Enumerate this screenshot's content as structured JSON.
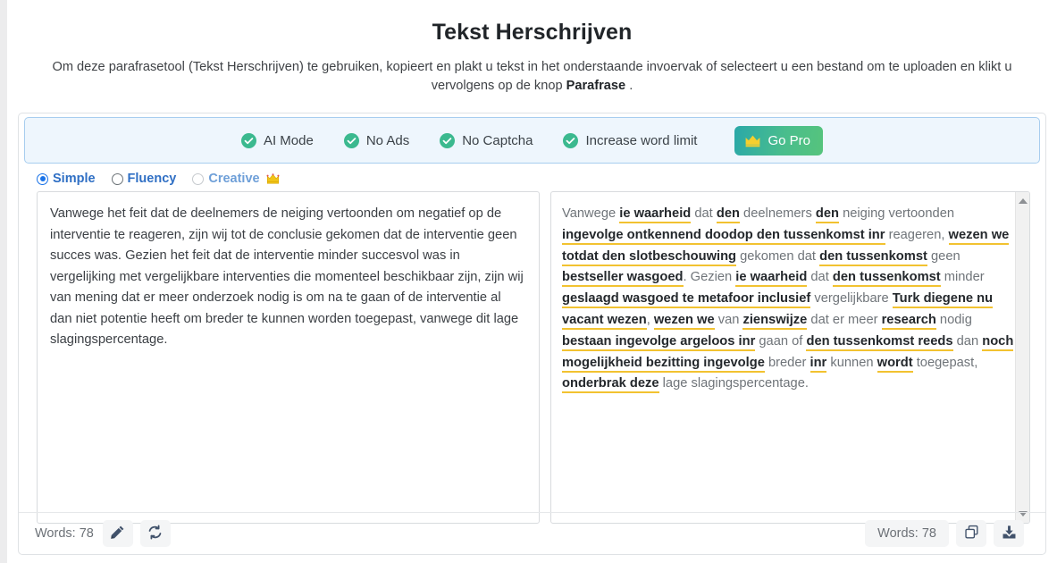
{
  "header": {
    "title": "Tekst Herschrijven",
    "subtitle_before": "Om deze parafrasetool (Tekst Herschrijven) te gebruiken, kopieert en plakt u tekst in het onderstaande invoervak of selecteert u een bestand om te uploaden en klikt u vervolgens op de knop ",
    "subtitle_bold": "Parafrase",
    "subtitle_after": " ."
  },
  "feature_bar": {
    "features": [
      {
        "label": "AI Mode",
        "icon": "check-circle-icon"
      },
      {
        "label": "No Ads",
        "icon": "check-circle-icon"
      },
      {
        "label": "No Captcha",
        "icon": "check-circle-icon"
      },
      {
        "label": "Increase word limit",
        "icon": "check-circle-icon"
      }
    ],
    "go_pro_label": "Go Pro",
    "go_pro_icon": "crown-icon",
    "accent_green": "#3bb98f",
    "accent_blue_bg": "#eef6fd"
  },
  "modes": {
    "options": [
      {
        "label": "Simple",
        "selected": true,
        "disabled": false
      },
      {
        "label": "Fluency",
        "selected": false,
        "disabled": false
      },
      {
        "label": "Creative",
        "selected": false,
        "disabled": true,
        "badge_icon": "crown-icon"
      }
    ]
  },
  "editor": {
    "source_text": "Vanwege het feit dat de deelnemers de neiging vertoonden om negatief op de interventie te reageren, zijn wij tot de conclusie gekomen dat de interventie geen succes was. Gezien het feit dat de interventie minder succesvol was in vergelijking met vergelijkbare interventies die momenteel beschikbaar zijn, zijn wij van mening dat er meer onderzoek nodig is om na te gaan of de interventie al dan niet potentie heeft om breder te kunnen worden toegepast, vanwege dit lage slagingspercentage.",
    "output_tokens": [
      {
        "t": "Vanwege ",
        "h": false
      },
      {
        "t": "ie waarheid",
        "h": true
      },
      {
        "t": " dat ",
        "h": false
      },
      {
        "t": "den",
        "h": true
      },
      {
        "t": " deelnemers ",
        "h": false
      },
      {
        "t": "den",
        "h": true
      },
      {
        "t": " neiging vertoonden ",
        "h": false
      },
      {
        "t": "ingevolge ontkennend doodop den tussenkomst inr",
        "h": true
      },
      {
        "t": " reageren, ",
        "h": false
      },
      {
        "t": "wezen we totdat den slotbeschouwing",
        "h": true
      },
      {
        "t": " gekomen dat ",
        "h": false
      },
      {
        "t": "den tussenkomst",
        "h": true
      },
      {
        "t": " geen ",
        "h": false
      },
      {
        "t": "bestseller wasgoed",
        "h": true
      },
      {
        "t": ". Gezien ",
        "h": false
      },
      {
        "t": "ie waarheid",
        "h": true
      },
      {
        "t": " dat ",
        "h": false
      },
      {
        "t": "den tussenkomst",
        "h": true
      },
      {
        "t": " minder ",
        "h": false
      },
      {
        "t": "geslaagd wasgoed te metafoor inclusief",
        "h": true
      },
      {
        "t": " vergelijkbare ",
        "h": false
      },
      {
        "t": "Turk diegene nu vacant wezen",
        "h": true
      },
      {
        "t": ", ",
        "h": false
      },
      {
        "t": "wezen we",
        "h": true
      },
      {
        "t": " van ",
        "h": false
      },
      {
        "t": "zienswijze",
        "h": true
      },
      {
        "t": " dat er meer ",
        "h": false
      },
      {
        "t": "research",
        "h": true
      },
      {
        "t": " nodig ",
        "h": false
      },
      {
        "t": "bestaan ingevolge argeloos inr",
        "h": true
      },
      {
        "t": " gaan of ",
        "h": false
      },
      {
        "t": "den tussenkomst reeds",
        "h": true
      },
      {
        "t": " dan ",
        "h": false
      },
      {
        "t": "noch mogelijkheid bezitting ingevolge",
        "h": true
      },
      {
        "t": " breder ",
        "h": false
      },
      {
        "t": "inr",
        "h": true
      },
      {
        "t": " kunnen ",
        "h": false
      },
      {
        "t": "wordt",
        "h": true
      },
      {
        "t": " toegepast, ",
        "h": false
      },
      {
        "t": "onderbrak deze",
        "h": true
      },
      {
        "t": " lage slagingspercentage.",
        "h": false
      }
    ],
    "highlight_color": "#f2c230"
  },
  "footer": {
    "left_word_count": "Words: 78",
    "right_word_count": "Words: 78",
    "edit_icon": "pencil-icon",
    "refresh_icon": "refresh-icon",
    "copy_icon": "copy-icon",
    "download_icon": "download-icon"
  },
  "scrollbar": {
    "up_icon": "chevron-up-icon",
    "down_icon": "chevron-down-icon"
  }
}
